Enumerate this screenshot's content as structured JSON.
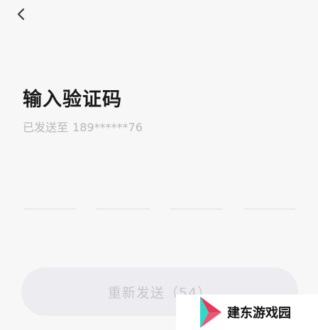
{
  "header": {
    "back_icon": "chevron-left-icon"
  },
  "page": {
    "title": "输入验证码",
    "sent_to_label": "已发送至",
    "phone_masked": "189******76"
  },
  "code_input": {
    "digits": [
      "",
      "",
      "",
      ""
    ]
  },
  "resend": {
    "label": "重新发送（54）"
  },
  "watermark": {
    "text": "建东游戏园",
    "logo_icon": "play-arrow-logo"
  },
  "colors": {
    "background": "#f7f7f8",
    "button_disabled_bg": "#ececf1",
    "button_disabled_text": "#c6c6cb",
    "muted_text": "#b8b8bc",
    "logo_red": "#e8385a",
    "logo_teal": "#33d6c8"
  }
}
